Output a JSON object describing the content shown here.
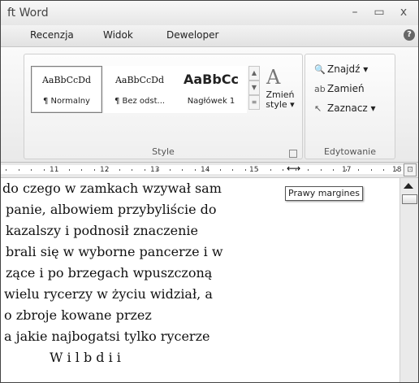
{
  "window": {
    "title": "ft Word",
    "minimize": "–",
    "maximize": "▭",
    "close": "x"
  },
  "tabs": [
    {
      "label": "Recenzja"
    },
    {
      "label": "Widok"
    },
    {
      "label": "Deweloper"
    }
  ],
  "help_label": "?",
  "styles_group": {
    "label": "Style",
    "items": [
      {
        "sample": "AaBbCcDd",
        "name": "¶ Normalny",
        "selected": true
      },
      {
        "sample": "AaBbCcDd",
        "name": "¶ Bez odst...",
        "selected": false
      },
      {
        "sample": "AaBbCc",
        "name": "Nagłówek 1",
        "selected": false
      }
    ],
    "change_style": {
      "glyph": "A",
      "label_line1": "Zmień",
      "label_line2": "style ▾"
    }
  },
  "editing_group": {
    "label": "Edytowanie",
    "items": [
      {
        "icon": "binoculars-icon",
        "glyph": "🔍",
        "label": "Znajdź ▾"
      },
      {
        "icon": "replace-icon",
        "glyph": "ab",
        "label": "Zamień"
      },
      {
        "icon": "select-cursor-icon",
        "glyph": "↖",
        "label": "Zaznacz ▾"
      }
    ]
  },
  "ruler": {
    "numbers": [
      "11",
      "12",
      "13",
      "14",
      "15",
      "17",
      "18"
    ]
  },
  "tooltip": "Prawy margines",
  "document": {
    "lines": [
      "do czego w zamkach wzywał sam",
      "panie, albowiem przybyliście do",
      "kazalszy i podnosił znaczenie",
      "brali się w wyborne pancerze i w",
      "zące i po brzegach wpuszczoną",
      " wielu rycerzy w życiu widział, a",
      "o zbroje kowane przez",
      "a jakie najbogatsi tylko rycerze",
      "W i l     b d      i  i"
    ]
  }
}
